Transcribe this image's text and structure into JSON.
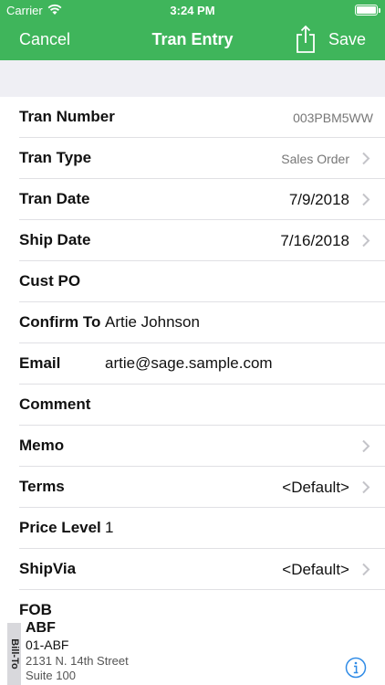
{
  "status_bar": {
    "carrier": "Carrier",
    "time": "3:24 PM"
  },
  "nav": {
    "cancel_label": "Cancel",
    "title": "Tran Entry",
    "save_label": "Save"
  },
  "fields": [
    {
      "label": "Tran Number",
      "value": "003PBM5WW"
    },
    {
      "label": "Tran Type",
      "value": "Sales Order"
    },
    {
      "label": "Tran Date",
      "value": "7/9/2018"
    },
    {
      "label": "Ship Date",
      "value": "7/16/2018"
    },
    {
      "label": "Cust PO",
      "value": ""
    },
    {
      "label": "Confirm To",
      "value": "Artie Johnson"
    },
    {
      "label": "Email",
      "value": "artie@sage.sample.com"
    },
    {
      "label": "Comment",
      "value": ""
    },
    {
      "label": "Memo",
      "value": ""
    },
    {
      "label": "Terms",
      "value": "<Default>"
    },
    {
      "label": "Price Level",
      "value": "1"
    },
    {
      "label": "ShipVia",
      "value": "<Default>"
    },
    {
      "label": "FOB",
      "value": ""
    }
  ],
  "bill_to": {
    "tab_label": "Bill-To",
    "name": "ABF",
    "code": "01-ABF",
    "address_line1": "2131 N. 14th Street",
    "address_line2": "Suite 100"
  },
  "colors": {
    "accent": "#3fb55b",
    "background": "#efeff4",
    "info_icon": "#2f8be6"
  },
  "icons": [
    "wifi-icon",
    "battery-icon",
    "share-icon",
    "chevron-right-icon",
    "info-icon"
  ]
}
